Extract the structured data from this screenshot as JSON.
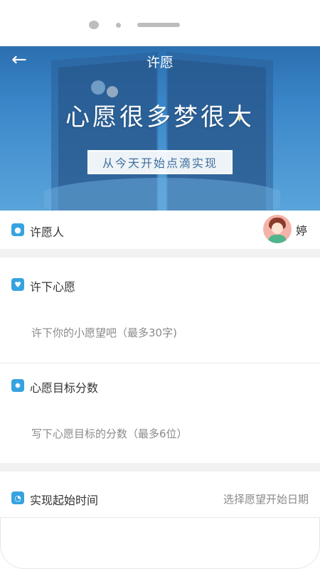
{
  "header": {
    "title": "许愿",
    "back_icon": "arrow-left-icon"
  },
  "banner": {
    "slogan": "心愿很多梦很大",
    "subslogan": "从今天开始点滴实现"
  },
  "wisher": {
    "label": "许愿人",
    "name": "婷"
  },
  "wish": {
    "label": "许下心愿",
    "placeholder": "许下你的小愿望吧（最多30字)"
  },
  "score": {
    "label": "心愿目标分数",
    "placeholder": "写下心愿目标的分数（最多6位）"
  },
  "start_time": {
    "label": "实现起始时间",
    "hint": "选择愿望开始日期"
  },
  "colors": {
    "accent": "#36a3e0",
    "banner": "#3a86c8"
  }
}
